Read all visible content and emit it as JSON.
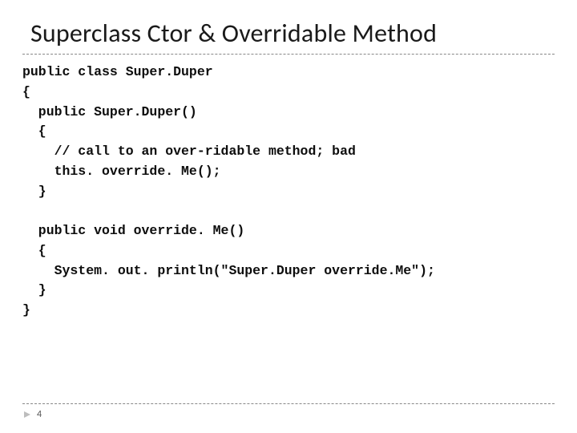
{
  "title": "Superclass Ctor & Overridable Method",
  "code": "public class Super.Duper\n{\n  public Super.Duper()\n  {\n    // call to an over-ridable method; bad\n    this. override. Me();\n  }\n\n  public void override. Me()\n  {\n    System. out. println(\"Super.Duper override.Me\");\n  }\n}",
  "page_number": "4"
}
